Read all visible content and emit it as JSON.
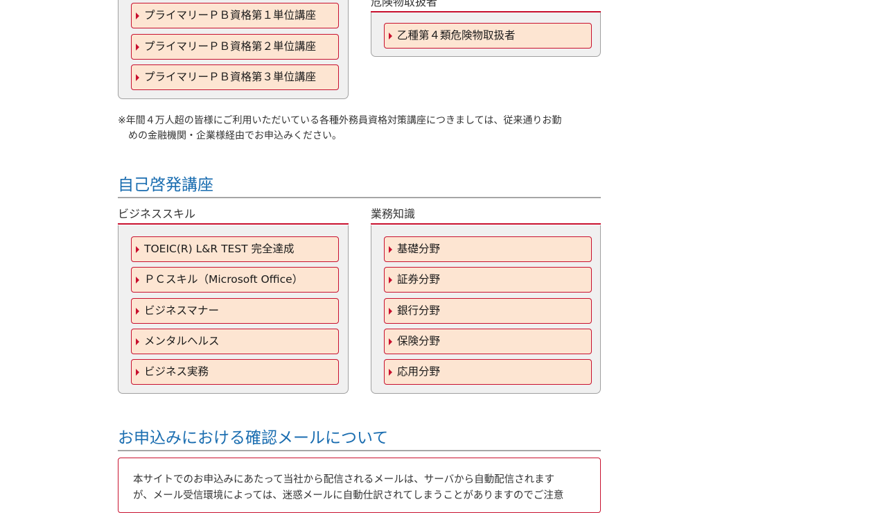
{
  "top_left_box": {
    "buttons": [
      "プライマリーＰＢ資格第１単位講座",
      "プライマリーＰＢ資格第２単位講座",
      "プライマリーＰＢ資格第３単位講座"
    ]
  },
  "top_right_box": {
    "title": "危険物取扱者",
    "buttons": [
      "乙種第４類危険物取扱者"
    ]
  },
  "note": {
    "line1": "※年間４万人超の皆様にご利用いただいている各種外務員資格対策講座につきましては、従来通りお勤",
    "line2": "めの金融機関・企業様経由でお申込みください。"
  },
  "self_development": {
    "title": "自己啓発講座",
    "business_skills": {
      "title": "ビジネススキル",
      "buttons": [
        "TOEIC(R) L&R TEST 完全達成",
        "ＰＣスキル（Microsoft Office）",
        "ビジネスマナー",
        "メンタルヘルス",
        "ビジネス実務"
      ]
    },
    "business_knowledge": {
      "title": "業務知識",
      "buttons": [
        "基礎分野",
        "証券分野",
        "銀行分野",
        "保険分野",
        "応用分野"
      ]
    }
  },
  "confirmation_mail": {
    "title": "お申込みにおける確認メールについて",
    "line1": "本サイトでのお申込みにあたって当社から配信されるメールは、サーバから自動配信されます",
    "line2": "が、メール受信環境によっては、迷惑メールに自動仕訳されてしまうことがありますのでご注意"
  },
  "colors": {
    "accent_red": "#c8102e",
    "button_fill": "#fde5d2",
    "heading_blue": "#1a6db0"
  }
}
